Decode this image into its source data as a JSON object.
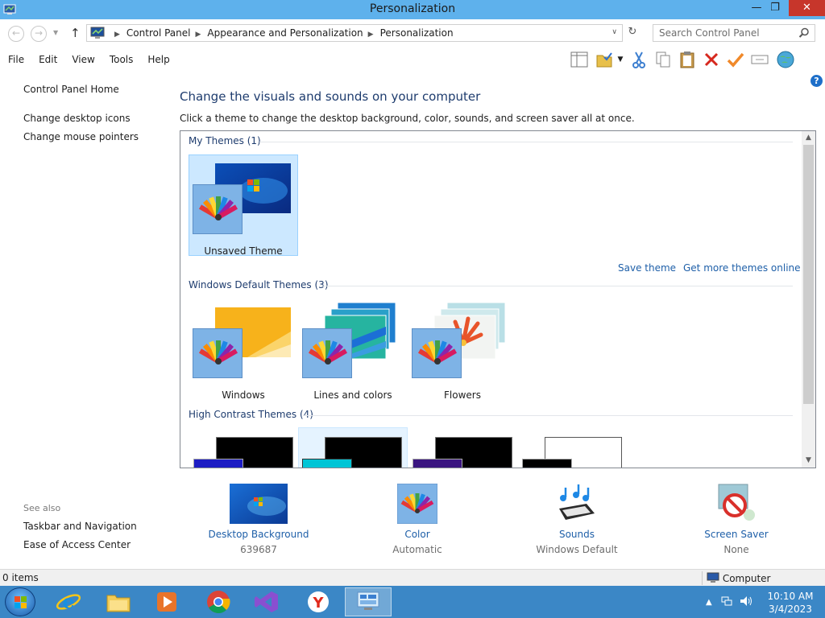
{
  "window": {
    "title": "Personalization",
    "minimize": "—",
    "maximize": "❐",
    "close": "✕"
  },
  "address": {
    "crumbs": [
      "Control Panel",
      "Appearance and Personalization",
      "Personalization"
    ],
    "search_placeholder": "Search Control Panel"
  },
  "menu": [
    "File",
    "Edit",
    "View",
    "Tools",
    "Help"
  ],
  "sidebar": {
    "home": "Control Panel Home",
    "links": [
      "Change desktop icons",
      "Change mouse pointers"
    ],
    "see_also_label": "See also",
    "see_also": [
      "Taskbar and Navigation",
      "Ease of Access Center"
    ]
  },
  "main": {
    "heading": "Change the visuals and sounds on your computer",
    "subtext": "Click a theme to change the desktop background, color, sounds, and screen saver all at once.",
    "my_themes": {
      "label": "My Themes (1)",
      "items": [
        "Unsaved Theme"
      ]
    },
    "save_theme": "Save theme",
    "get_more": "Get more themes online",
    "default_themes": {
      "label": "Windows Default Themes (3)",
      "items": [
        "Windows",
        "Lines and colors",
        "Flowers"
      ]
    },
    "high_contrast": {
      "label": "High Contrast Themes (4)"
    }
  },
  "options": [
    {
      "title": "Desktop Background",
      "value": "639687"
    },
    {
      "title": "Color",
      "value": "Automatic"
    },
    {
      "title": "Sounds",
      "value": "Windows Default"
    },
    {
      "title": "Screen Saver",
      "value": "None"
    }
  ],
  "status": {
    "items": "0 items",
    "location": "Computer"
  },
  "clock": {
    "time": "10:10 AM",
    "date": "3/4/2023"
  },
  "colors": {
    "titlebar": "#5eb1ec",
    "taskbar": "#3b87c6",
    "link": "#1e5fa8",
    "heading": "#1e3c6e"
  }
}
